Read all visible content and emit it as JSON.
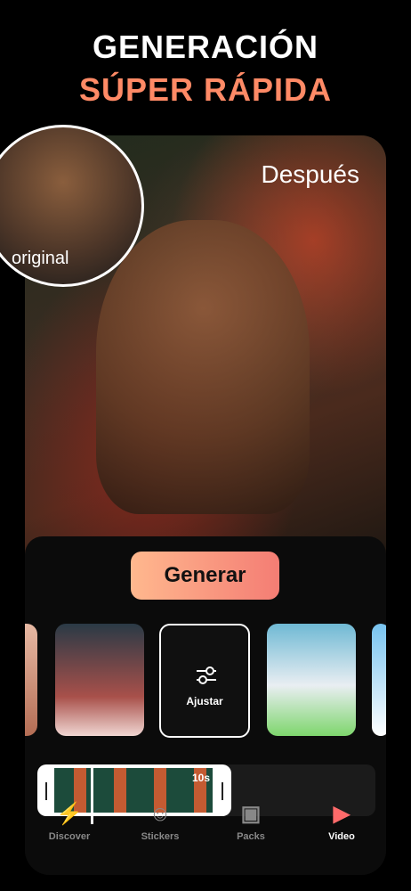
{
  "header": {
    "line1": "GENERACIÓN",
    "line2": "SÚPER RÁPIDA"
  },
  "labels": {
    "after": "Después",
    "original": "original"
  },
  "buttons": {
    "generate": "Generar"
  },
  "templates": [
    {
      "label": ""
    },
    {
      "label": ""
    },
    {
      "label": "Ajustar"
    },
    {
      "label": ""
    },
    {
      "label": ""
    }
  ],
  "timeline": {
    "duration": "10s"
  },
  "nav": {
    "items": [
      {
        "label": "Discover",
        "icon": "bolt-icon"
      },
      {
        "label": "Stickers",
        "icon": "sticker-icon"
      },
      {
        "label": "Packs",
        "icon": "packs-icon"
      },
      {
        "label": "Video",
        "icon": "play-icon"
      }
    ]
  },
  "colors": {
    "accent": "#ff8a66",
    "button_gradient_start": "#ffb88e",
    "button_gradient_end": "#f47d74"
  }
}
